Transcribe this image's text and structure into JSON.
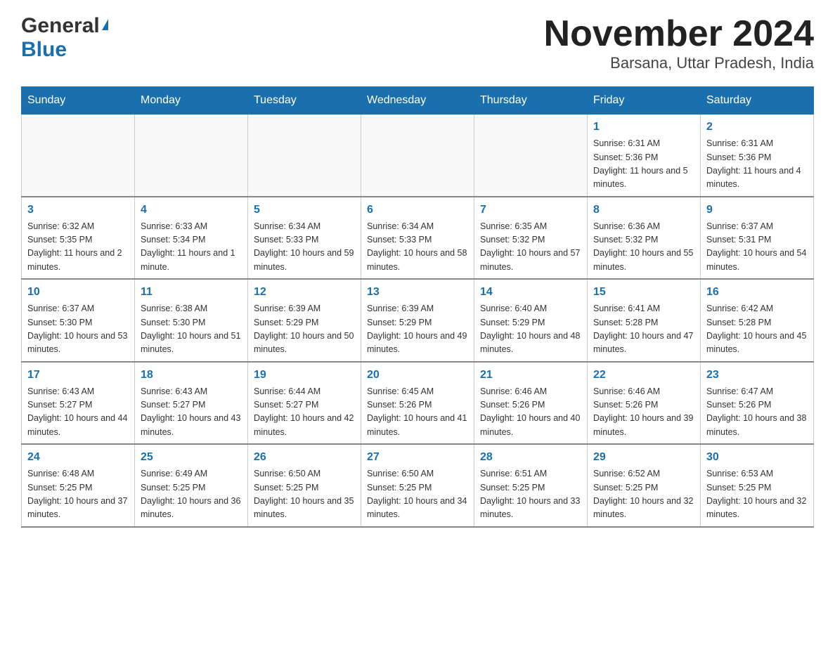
{
  "header": {
    "logo_general": "General",
    "logo_blue": "Blue",
    "title": "November 2024",
    "subtitle": "Barsana, Uttar Pradesh, India"
  },
  "days_of_week": [
    "Sunday",
    "Monday",
    "Tuesday",
    "Wednesday",
    "Thursday",
    "Friday",
    "Saturday"
  ],
  "weeks": [
    {
      "days": [
        {
          "number": "",
          "info": ""
        },
        {
          "number": "",
          "info": ""
        },
        {
          "number": "",
          "info": ""
        },
        {
          "number": "",
          "info": ""
        },
        {
          "number": "",
          "info": ""
        },
        {
          "number": "1",
          "info": "Sunrise: 6:31 AM\nSunset: 5:36 PM\nDaylight: 11 hours and 5 minutes."
        },
        {
          "number": "2",
          "info": "Sunrise: 6:31 AM\nSunset: 5:36 PM\nDaylight: 11 hours and 4 minutes."
        }
      ]
    },
    {
      "days": [
        {
          "number": "3",
          "info": "Sunrise: 6:32 AM\nSunset: 5:35 PM\nDaylight: 11 hours and 2 minutes."
        },
        {
          "number": "4",
          "info": "Sunrise: 6:33 AM\nSunset: 5:34 PM\nDaylight: 11 hours and 1 minute."
        },
        {
          "number": "5",
          "info": "Sunrise: 6:34 AM\nSunset: 5:33 PM\nDaylight: 10 hours and 59 minutes."
        },
        {
          "number": "6",
          "info": "Sunrise: 6:34 AM\nSunset: 5:33 PM\nDaylight: 10 hours and 58 minutes."
        },
        {
          "number": "7",
          "info": "Sunrise: 6:35 AM\nSunset: 5:32 PM\nDaylight: 10 hours and 57 minutes."
        },
        {
          "number": "8",
          "info": "Sunrise: 6:36 AM\nSunset: 5:32 PM\nDaylight: 10 hours and 55 minutes."
        },
        {
          "number": "9",
          "info": "Sunrise: 6:37 AM\nSunset: 5:31 PM\nDaylight: 10 hours and 54 minutes."
        }
      ]
    },
    {
      "days": [
        {
          "number": "10",
          "info": "Sunrise: 6:37 AM\nSunset: 5:30 PM\nDaylight: 10 hours and 53 minutes."
        },
        {
          "number": "11",
          "info": "Sunrise: 6:38 AM\nSunset: 5:30 PM\nDaylight: 10 hours and 51 minutes."
        },
        {
          "number": "12",
          "info": "Sunrise: 6:39 AM\nSunset: 5:29 PM\nDaylight: 10 hours and 50 minutes."
        },
        {
          "number": "13",
          "info": "Sunrise: 6:39 AM\nSunset: 5:29 PM\nDaylight: 10 hours and 49 minutes."
        },
        {
          "number": "14",
          "info": "Sunrise: 6:40 AM\nSunset: 5:29 PM\nDaylight: 10 hours and 48 minutes."
        },
        {
          "number": "15",
          "info": "Sunrise: 6:41 AM\nSunset: 5:28 PM\nDaylight: 10 hours and 47 minutes."
        },
        {
          "number": "16",
          "info": "Sunrise: 6:42 AM\nSunset: 5:28 PM\nDaylight: 10 hours and 45 minutes."
        }
      ]
    },
    {
      "days": [
        {
          "number": "17",
          "info": "Sunrise: 6:43 AM\nSunset: 5:27 PM\nDaylight: 10 hours and 44 minutes."
        },
        {
          "number": "18",
          "info": "Sunrise: 6:43 AM\nSunset: 5:27 PM\nDaylight: 10 hours and 43 minutes."
        },
        {
          "number": "19",
          "info": "Sunrise: 6:44 AM\nSunset: 5:27 PM\nDaylight: 10 hours and 42 minutes."
        },
        {
          "number": "20",
          "info": "Sunrise: 6:45 AM\nSunset: 5:26 PM\nDaylight: 10 hours and 41 minutes."
        },
        {
          "number": "21",
          "info": "Sunrise: 6:46 AM\nSunset: 5:26 PM\nDaylight: 10 hours and 40 minutes."
        },
        {
          "number": "22",
          "info": "Sunrise: 6:46 AM\nSunset: 5:26 PM\nDaylight: 10 hours and 39 minutes."
        },
        {
          "number": "23",
          "info": "Sunrise: 6:47 AM\nSunset: 5:26 PM\nDaylight: 10 hours and 38 minutes."
        }
      ]
    },
    {
      "days": [
        {
          "number": "24",
          "info": "Sunrise: 6:48 AM\nSunset: 5:25 PM\nDaylight: 10 hours and 37 minutes."
        },
        {
          "number": "25",
          "info": "Sunrise: 6:49 AM\nSunset: 5:25 PM\nDaylight: 10 hours and 36 minutes."
        },
        {
          "number": "26",
          "info": "Sunrise: 6:50 AM\nSunset: 5:25 PM\nDaylight: 10 hours and 35 minutes."
        },
        {
          "number": "27",
          "info": "Sunrise: 6:50 AM\nSunset: 5:25 PM\nDaylight: 10 hours and 34 minutes."
        },
        {
          "number": "28",
          "info": "Sunrise: 6:51 AM\nSunset: 5:25 PM\nDaylight: 10 hours and 33 minutes."
        },
        {
          "number": "29",
          "info": "Sunrise: 6:52 AM\nSunset: 5:25 PM\nDaylight: 10 hours and 32 minutes."
        },
        {
          "number": "30",
          "info": "Sunrise: 6:53 AM\nSunset: 5:25 PM\nDaylight: 10 hours and 32 minutes."
        }
      ]
    }
  ]
}
